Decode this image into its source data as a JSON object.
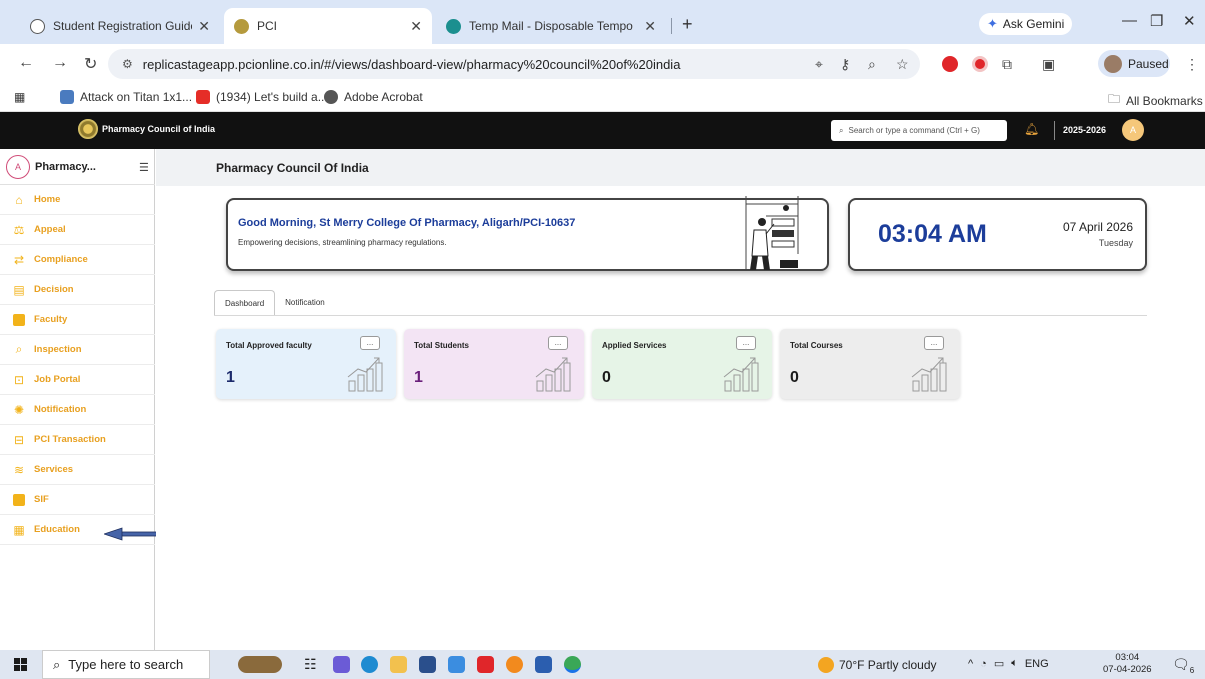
{
  "browser": {
    "tabs": [
      {
        "title": "Student Registration Guide",
        "active": false
      },
      {
        "title": "PCI",
        "active": true
      },
      {
        "title": "Temp Mail - Disposable Tempo",
        "active": false
      }
    ],
    "ask_gemini": "Ask Gemini",
    "url": "replicastageapp.pcionline.co.in/#/views/dashboard-view/pharmacy%20council%20of%20india",
    "profile_status": "Paused",
    "bookmarks": [
      {
        "label": "Attack on Titan 1x1..."
      },
      {
        "label": "(1934) Let's build a..."
      },
      {
        "label": "Adobe Acrobat"
      }
    ],
    "all_bookmarks": "All Bookmarks"
  },
  "app": {
    "brand": "Pharmacy Council of India",
    "search_placeholder": "Search or type a command (Ctrl + G)",
    "year": "2025-2026",
    "avatar_initial": "A"
  },
  "sidebar": {
    "avatar_initial": "A",
    "user_name": "Pharmacy...",
    "items": [
      {
        "label": "Home",
        "icon": "home-icon"
      },
      {
        "label": "Appeal",
        "icon": "appeal-icon"
      },
      {
        "label": "Compliance",
        "icon": "compliance-icon"
      },
      {
        "label": "Decision",
        "icon": "decision-icon"
      },
      {
        "label": "Faculty",
        "icon": "faculty-icon"
      },
      {
        "label": "Inspection",
        "icon": "inspection-icon"
      },
      {
        "label": "Job Portal",
        "icon": "job-portal-icon"
      },
      {
        "label": "Notification",
        "icon": "notification-icon"
      },
      {
        "label": "PCI Transaction",
        "icon": "transaction-icon"
      },
      {
        "label": "Services",
        "icon": "services-icon"
      },
      {
        "label": "SIF",
        "icon": "sif-icon"
      },
      {
        "label": "Education",
        "icon": "education-icon"
      }
    ],
    "accent_color": "#e8a020"
  },
  "main": {
    "page_title": "Pharmacy Council Of India",
    "greeting": {
      "title": "Good Morning, St Merry College Of Pharmacy, Aligarh/PCI-10637",
      "subtitle": "Empowering decisions, streamlining pharmacy regulations."
    },
    "clock": {
      "time": "03:04 AM",
      "date": "07 April 2026",
      "day": "Tuesday"
    },
    "tabs": [
      {
        "label": "Dashboard",
        "active": true
      },
      {
        "label": "Notification",
        "active": false
      }
    ],
    "stats": [
      {
        "title": "Total Approved faculty",
        "value": "1",
        "bg": "#e5f1fb",
        "value_color": "#1c2a6b"
      },
      {
        "title": "Total Students",
        "value": "1",
        "bg": "#f3e4f4",
        "value_color": "#6a1f7a"
      },
      {
        "title": "Applied Services",
        "value": "0",
        "bg": "#e6f4e7",
        "value_color": "#1b1b1b"
      },
      {
        "title": "Total Courses",
        "value": "0",
        "bg": "#ededed",
        "value_color": "#1b1b1b"
      }
    ],
    "more_label": "..."
  },
  "taskbar": {
    "search_placeholder": "Type here to search",
    "weather": "70°F  Partly cloudy",
    "language": "ENG",
    "time": "03:04",
    "date": "07-04-2026",
    "notification_count": "6"
  }
}
